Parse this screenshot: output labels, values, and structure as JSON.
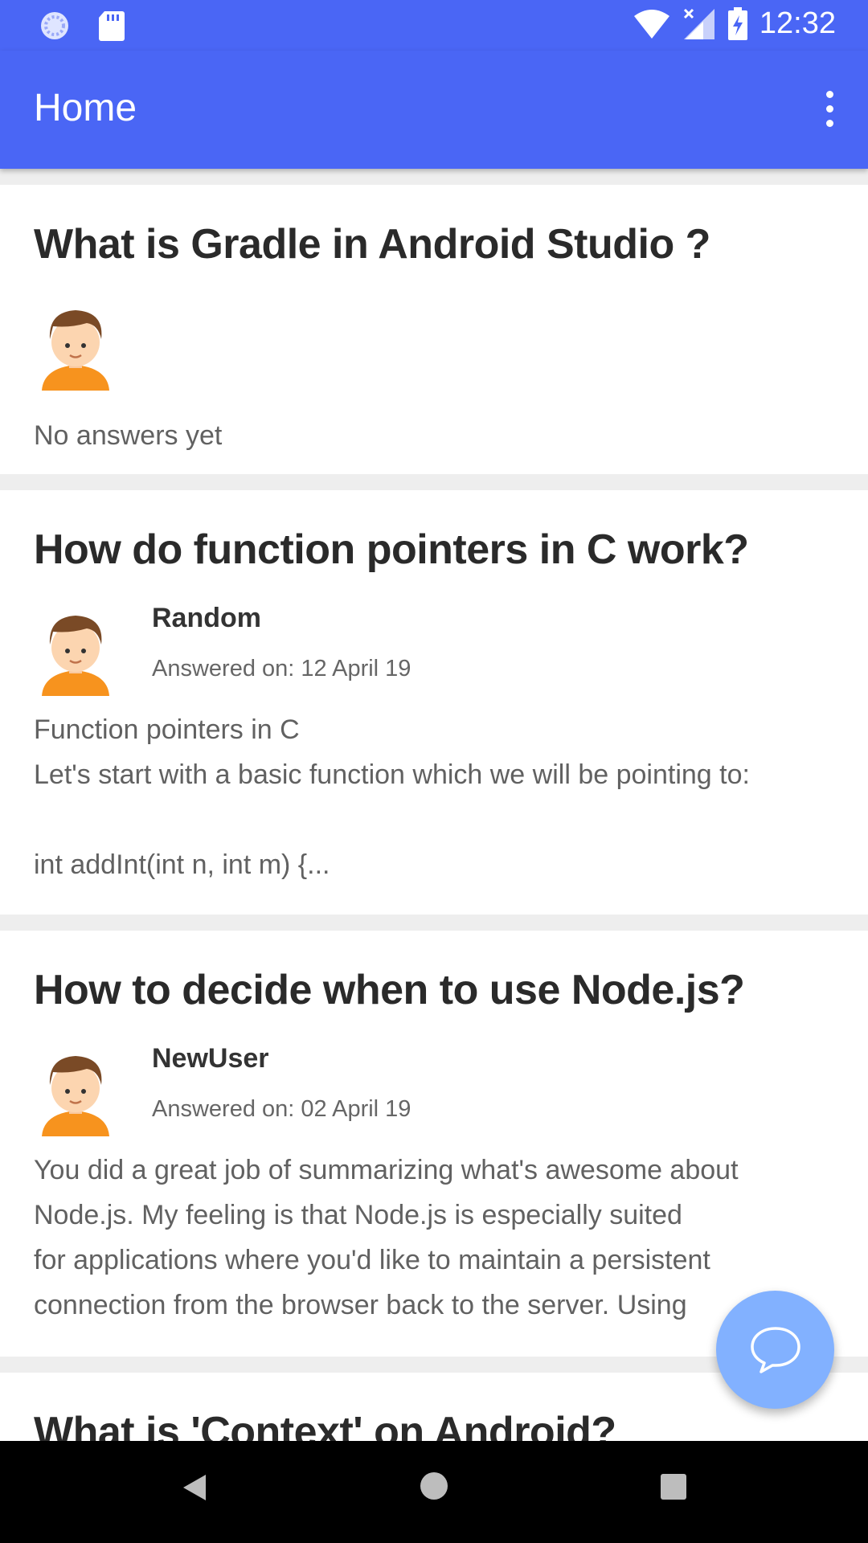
{
  "status_bar": {
    "time": "12:32",
    "icons": [
      "sync-icon",
      "sd-card-icon",
      "wifi-icon",
      "signal-icon",
      "battery-charging-icon"
    ]
  },
  "app_bar": {
    "title": "Home",
    "overflow_icon": "more-vert-icon"
  },
  "feed": {
    "questions": [
      {
        "title": "What is Gradle in Android Studio ?",
        "avatar_icon": "user-avatar-icon",
        "no_answer_text": "No answers yet"
      },
      {
        "title": "How do function pointers in C work?",
        "avatar_icon": "user-avatar-icon",
        "author": "Random",
        "answered_on": "Answered on: 12 April 19",
        "excerpt": "Function pointers in C\nLet's start with a basic function which we will be pointing to:\n\nint addInt(int n, int m) {..."
      },
      {
        "title": "How to decide when to use Node.js?",
        "avatar_icon": "user-avatar-icon",
        "author": "NewUser",
        "answered_on": "Answered on: 02 April 19",
        "excerpt": "You did a great job of summarizing what's awesome about\nNode.js. My feeling is that Node.js is especially suited\nfor applications where you'd like to maintain a persistent\nconnection from the browser back to the server. Using"
      },
      {
        "title": "What is 'Context' on Android?"
      }
    ]
  },
  "fab": {
    "icon": "chat-bubble-icon"
  },
  "nav_bar": {
    "icons": [
      "back-icon",
      "home-icon",
      "recents-icon"
    ]
  },
  "colors": {
    "primary": "#4a66f5",
    "fab": "#82b1ff",
    "divider": "#eeeeee"
  }
}
